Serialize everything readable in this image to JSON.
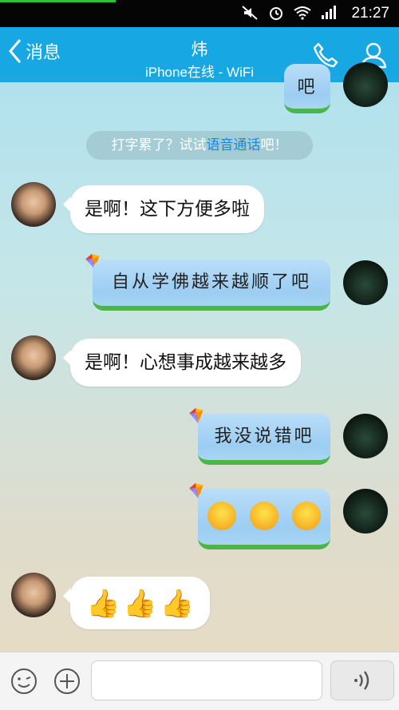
{
  "statusbar": {
    "time": "21:27",
    "icons": [
      "mute-icon",
      "alarm-icon",
      "wifi-icon",
      "signal-icon"
    ]
  },
  "header": {
    "back_label": "消息",
    "title": "炜",
    "subtitle": "iPhone在线 - WiFi",
    "icons": [
      "back-chevron-icon",
      "phone-icon",
      "profile-icon"
    ]
  },
  "messages": {
    "partial_top": "吧",
    "system": {
      "prefix": "打字累了？试试",
      "link": "语音通话",
      "suffix": "吧！"
    },
    "m1": "是啊！这下方便多啦",
    "m2": "自从学佛越来越顺了吧",
    "m3": "是啊！心想事成越来越多",
    "m4": "我没说错吧",
    "m5_emoji": "smile-emoji ×3",
    "m6_emoji": "thumbs-up ×3"
  },
  "bottombar": {
    "icons": [
      "emoji-icon",
      "plus-icon",
      "voice-icon"
    ]
  },
  "colors": {
    "header": "#17a8e3",
    "bubble_blue": "#a9d6f5",
    "bubble_base": "#4bb54a"
  }
}
